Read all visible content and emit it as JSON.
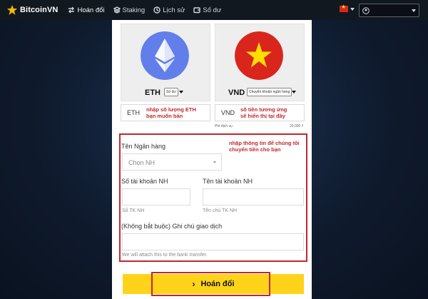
{
  "nav": {
    "brand": "BitcoinVN",
    "items": [
      {
        "label": "Hoán đổi",
        "icon": "swap-icon",
        "active": true
      },
      {
        "label": "Staking",
        "icon": "layers-icon",
        "active": false
      },
      {
        "label": "Lịch sử",
        "icon": "history-icon",
        "active": false
      },
      {
        "label": "Số dư",
        "icon": "wallet-icon",
        "active": false
      }
    ],
    "flag_icon": "vietnam-flag-icon"
  },
  "swap": {
    "from": {
      "code": "ETH",
      "source_label": "Số dư",
      "amount_code": "ETH",
      "note": [
        "nhập số lượng ETH",
        "bạn muốn bán"
      ]
    },
    "to": {
      "code": "VND",
      "method_label": "Chuyển khoản ngân hàng",
      "amount_code": "VND",
      "note": [
        "số tiền tương ứng",
        "sẽ hiển thị tại đây"
      ]
    },
    "fee_label": "Phí dịch vụ",
    "fee_value": "20,000 ₫"
  },
  "bank": {
    "note": [
      "nhập thông tin để chúng tôi",
      "chuyển tiền cho bạn"
    ],
    "bank_label": "Tên Ngân hàng",
    "bank_placeholder": "Chọn NH",
    "account_no_label": "Số tài khoản NH",
    "account_no_hint": "Số TK NH",
    "account_name_label": "Tên tài khoản NH",
    "account_name_hint": "Tên chủ TK NH",
    "memo_label": "(Không bắt buộc) Ghi chú giao dịch",
    "memo_hint": "We will attach this to the bank transfer."
  },
  "submit_label": "Hoán đổi",
  "colors": {
    "accent": "#ffd31a",
    "highlight": "#c1272d",
    "eth": "#627eea",
    "vnd_red": "#da251d",
    "vnd_star": "#ffde00"
  }
}
